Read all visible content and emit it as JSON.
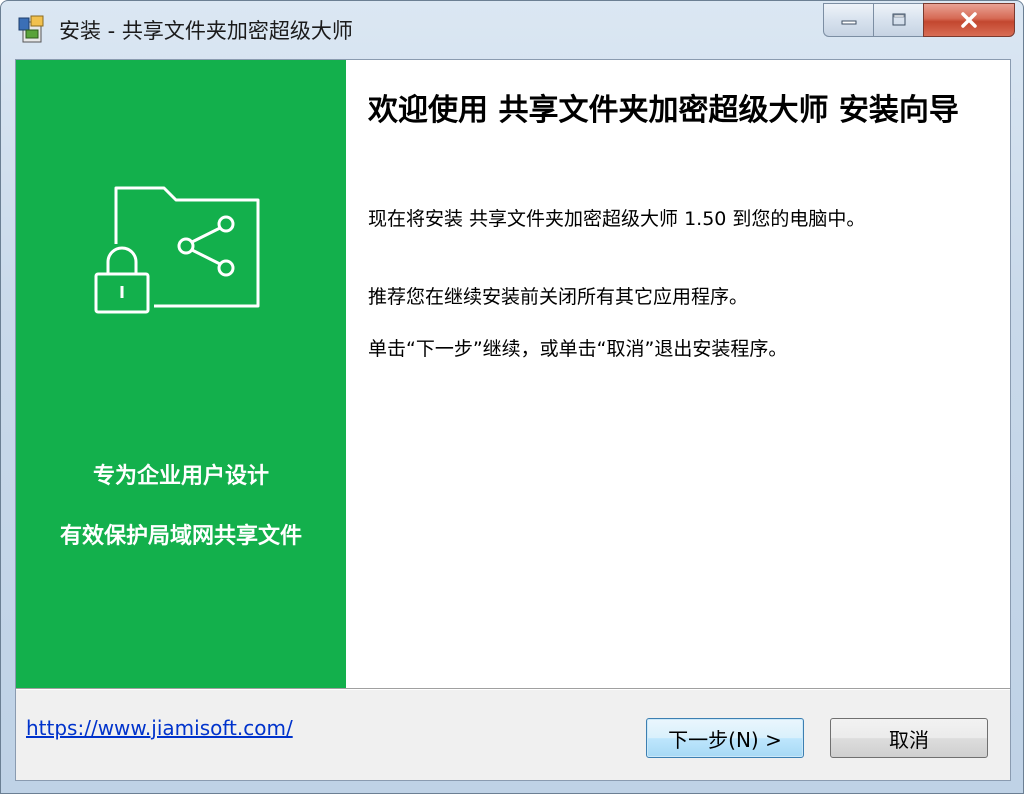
{
  "window": {
    "title": "安装 - 共享文件夹加密超级大师"
  },
  "side_panel": {
    "background_color": "#13b04c",
    "illustration": "folder-share-lock-icon",
    "slogans": [
      "专为企业用户设计",
      "有效保护局域网共享文件"
    ]
  },
  "main_panel": {
    "heading": "欢迎使用 共享文件夹加密超级大师 安装向导",
    "paragraphs": [
      "现在将安装 共享文件夹加密超级大师 1.50 到您的电脑中。",
      "推荐您在继续安装前关闭所有其它应用程序。",
      "单击“下一步”继续，或单击“取消”退出安装程序。"
    ]
  },
  "footer": {
    "link_text": "https://www.jiamisoft.com/",
    "next_label": "下一步(N) >",
    "cancel_label": "取消"
  }
}
